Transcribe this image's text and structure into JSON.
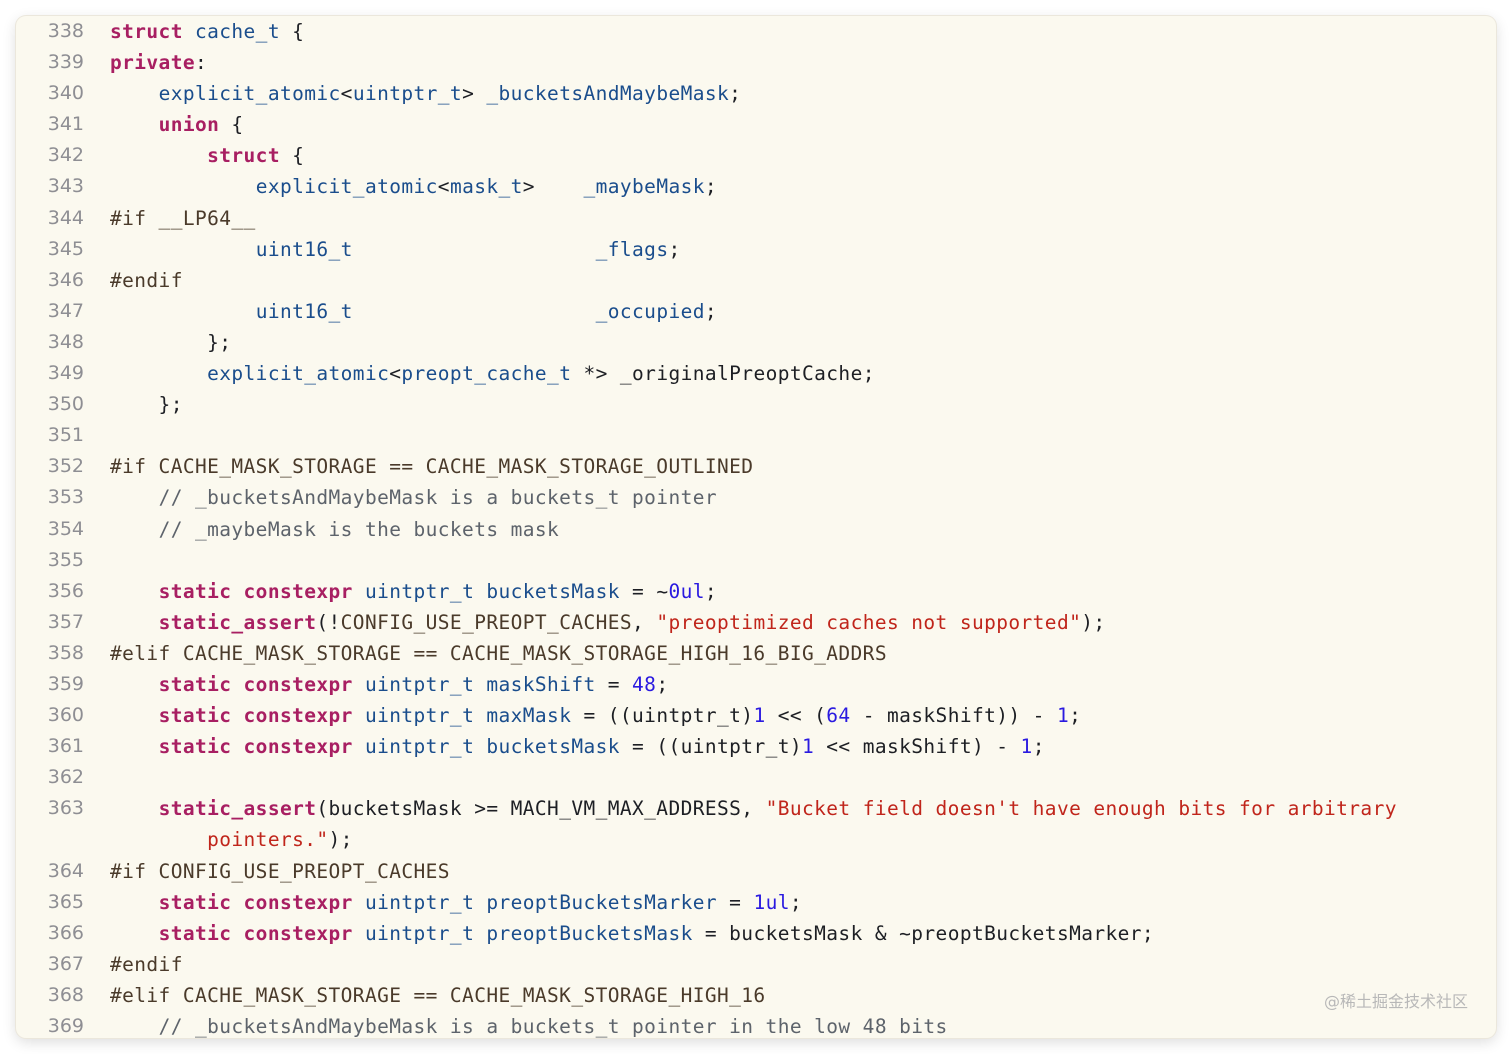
{
  "editor": {
    "colors": {
      "background": "#fbf9ef",
      "line_number": "#8e8e93",
      "keyword": "#a81f62",
      "type": "#1a4d8c",
      "preprocessor": "#4a3a2a",
      "comment": "#5d636b",
      "string": "#c0251b",
      "number": "#2a1ae0",
      "plain": "#1d1f24"
    },
    "lines": [
      {
        "num": "338",
        "tokens": [
          {
            "t": "struct",
            "c": "kw"
          },
          {
            "t": " "
          },
          {
            "t": "cache_t",
            "c": "ty"
          },
          {
            "t": " {"
          }
        ]
      },
      {
        "num": "339",
        "tokens": [
          {
            "t": "private",
            "c": "kw"
          },
          {
            "t": ":"
          }
        ]
      },
      {
        "num": "340",
        "tokens": [
          {
            "t": "    "
          },
          {
            "t": "explicit_atomic",
            "c": "ty"
          },
          {
            "t": "<"
          },
          {
            "t": "uintptr_t",
            "c": "ty"
          },
          {
            "t": "> "
          },
          {
            "t": "_bucketsAndMaybeMask",
            "c": "sy"
          },
          {
            "t": ";"
          }
        ]
      },
      {
        "num": "341",
        "tokens": [
          {
            "t": "    "
          },
          {
            "t": "union",
            "c": "kw"
          },
          {
            "t": " {"
          }
        ]
      },
      {
        "num": "342",
        "tokens": [
          {
            "t": "        "
          },
          {
            "t": "struct",
            "c": "kw"
          },
          {
            "t": " {"
          }
        ]
      },
      {
        "num": "343",
        "tokens": [
          {
            "t": "            "
          },
          {
            "t": "explicit_atomic",
            "c": "ty"
          },
          {
            "t": "<"
          },
          {
            "t": "mask_t",
            "c": "ty"
          },
          {
            "t": ">    "
          },
          {
            "t": "_maybeMask",
            "c": "sy"
          },
          {
            "t": ";"
          }
        ]
      },
      {
        "num": "344",
        "tokens": [
          {
            "t": "#if __LP64__",
            "c": "pp"
          }
        ]
      },
      {
        "num": "345",
        "tokens": [
          {
            "t": "            "
          },
          {
            "t": "uint16_t",
            "c": "ty"
          },
          {
            "t": "                    "
          },
          {
            "t": "_flags",
            "c": "sy"
          },
          {
            "t": ";"
          }
        ]
      },
      {
        "num": "346",
        "tokens": [
          {
            "t": "#endif",
            "c": "pp"
          }
        ]
      },
      {
        "num": "347",
        "tokens": [
          {
            "t": "            "
          },
          {
            "t": "uint16_t",
            "c": "ty"
          },
          {
            "t": "                    "
          },
          {
            "t": "_occupied",
            "c": "sy"
          },
          {
            "t": ";"
          }
        ]
      },
      {
        "num": "348",
        "tokens": [
          {
            "t": "        };"
          }
        ]
      },
      {
        "num": "349",
        "tokens": [
          {
            "t": "        "
          },
          {
            "t": "explicit_atomic",
            "c": "ty"
          },
          {
            "t": "<"
          },
          {
            "t": "preopt_cache_t",
            "c": "ty"
          },
          {
            "t": " *> _originalPreoptCache;"
          }
        ]
      },
      {
        "num": "350",
        "tokens": [
          {
            "t": "    };"
          }
        ]
      },
      {
        "num": "351",
        "tokens": []
      },
      {
        "num": "352",
        "tokens": [
          {
            "t": "#if CACHE_MASK_STORAGE == CACHE_MASK_STORAGE_OUTLINED",
            "c": "pp"
          }
        ]
      },
      {
        "num": "353",
        "tokens": [
          {
            "t": "    "
          },
          {
            "t": "// _bucketsAndMaybeMask is a buckets_t pointer",
            "c": "cm"
          }
        ]
      },
      {
        "num": "354",
        "tokens": [
          {
            "t": "    "
          },
          {
            "t": "// _maybeMask is the buckets mask",
            "c": "cm"
          }
        ]
      },
      {
        "num": "355",
        "tokens": []
      },
      {
        "num": "356",
        "tokens": [
          {
            "t": "    "
          },
          {
            "t": "static",
            "c": "kw"
          },
          {
            "t": " "
          },
          {
            "t": "constexpr",
            "c": "kw"
          },
          {
            "t": " "
          },
          {
            "t": "uintptr_t",
            "c": "ty"
          },
          {
            "t": " "
          },
          {
            "t": "bucketsMask",
            "c": "sy"
          },
          {
            "t": " = ~"
          },
          {
            "t": "0ul",
            "c": "nu"
          },
          {
            "t": ";"
          }
        ]
      },
      {
        "num": "357",
        "tokens": [
          {
            "t": "    "
          },
          {
            "t": "static_assert",
            "c": "kw"
          },
          {
            "t": "(!"
          },
          {
            "t": "CONFIG_USE_PREOPT_CACHES",
            "c": "pp"
          },
          {
            "t": ", "
          },
          {
            "t": "\"preoptimized caches not supported\"",
            "c": "st"
          },
          {
            "t": ");"
          }
        ]
      },
      {
        "num": "358",
        "tokens": [
          {
            "t": "#elif CACHE_MASK_STORAGE == CACHE_MASK_STORAGE_HIGH_16_BIG_ADDRS",
            "c": "pp"
          }
        ]
      },
      {
        "num": "359",
        "tokens": [
          {
            "t": "    "
          },
          {
            "t": "static",
            "c": "kw"
          },
          {
            "t": " "
          },
          {
            "t": "constexpr",
            "c": "kw"
          },
          {
            "t": " "
          },
          {
            "t": "uintptr_t",
            "c": "ty"
          },
          {
            "t": " "
          },
          {
            "t": "maskShift",
            "c": "sy"
          },
          {
            "t": " = "
          },
          {
            "t": "48",
            "c": "nu"
          },
          {
            "t": ";"
          }
        ]
      },
      {
        "num": "360",
        "tokens": [
          {
            "t": "    "
          },
          {
            "t": "static",
            "c": "kw"
          },
          {
            "t": " "
          },
          {
            "t": "constexpr",
            "c": "kw"
          },
          {
            "t": " "
          },
          {
            "t": "uintptr_t",
            "c": "ty"
          },
          {
            "t": " "
          },
          {
            "t": "maxMask",
            "c": "sy"
          },
          {
            "t": " = ((uintptr_t)"
          },
          {
            "t": "1",
            "c": "nu"
          },
          {
            "t": " << ("
          },
          {
            "t": "64",
            "c": "nu"
          },
          {
            "t": " - maskShift)) - "
          },
          {
            "t": "1",
            "c": "nu"
          },
          {
            "t": ";"
          }
        ]
      },
      {
        "num": "361",
        "tokens": [
          {
            "t": "    "
          },
          {
            "t": "static",
            "c": "kw"
          },
          {
            "t": " "
          },
          {
            "t": "constexpr",
            "c": "kw"
          },
          {
            "t": " "
          },
          {
            "t": "uintptr_t",
            "c": "ty"
          },
          {
            "t": " "
          },
          {
            "t": "bucketsMask",
            "c": "sy"
          },
          {
            "t": " = ((uintptr_t)"
          },
          {
            "t": "1",
            "c": "nu"
          },
          {
            "t": " << maskShift) - "
          },
          {
            "t": "1",
            "c": "nu"
          },
          {
            "t": ";"
          }
        ]
      },
      {
        "num": "362",
        "tokens": []
      },
      {
        "num": "363",
        "wrap": true,
        "tokens": [
          {
            "t": "    "
          },
          {
            "t": "static_assert",
            "c": "kw"
          },
          {
            "t": "(bucketsMask >= MACH_VM_MAX_ADDRESS, "
          },
          {
            "t": "\"Bucket field doesn't have enough bits for arbitrary\n        pointers.\"",
            "c": "st"
          },
          {
            "t": ");"
          }
        ]
      },
      {
        "num": "364",
        "tokens": [
          {
            "t": "#if CONFIG_USE_PREOPT_CACHES",
            "c": "pp"
          }
        ]
      },
      {
        "num": "365",
        "tokens": [
          {
            "t": "    "
          },
          {
            "t": "static",
            "c": "kw"
          },
          {
            "t": " "
          },
          {
            "t": "constexpr",
            "c": "kw"
          },
          {
            "t": " "
          },
          {
            "t": "uintptr_t",
            "c": "ty"
          },
          {
            "t": " "
          },
          {
            "t": "preoptBucketsMarker",
            "c": "sy"
          },
          {
            "t": " = "
          },
          {
            "t": "1ul",
            "c": "nu"
          },
          {
            "t": ";"
          }
        ]
      },
      {
        "num": "366",
        "tokens": [
          {
            "t": "    "
          },
          {
            "t": "static",
            "c": "kw"
          },
          {
            "t": " "
          },
          {
            "t": "constexpr",
            "c": "kw"
          },
          {
            "t": " "
          },
          {
            "t": "uintptr_t",
            "c": "ty"
          },
          {
            "t": " "
          },
          {
            "t": "preoptBucketsMask",
            "c": "sy"
          },
          {
            "t": " = bucketsMask & ~preoptBucketsMarker;"
          }
        ]
      },
      {
        "num": "367",
        "tokens": [
          {
            "t": "#endif",
            "c": "pp"
          }
        ]
      },
      {
        "num": "368",
        "tokens": [
          {
            "t": "#elif CACHE_MASK_STORAGE == CACHE_MASK_STORAGE_HIGH_16",
            "c": "pp"
          }
        ]
      },
      {
        "num": "369",
        "tokens": [
          {
            "t": "    "
          },
          {
            "t": "// _bucketsAndMaybeMask is a buckets_t pointer in the low 48 bits",
            "c": "cm"
          }
        ]
      }
    ]
  },
  "watermark": "@稀土掘金技术社区"
}
